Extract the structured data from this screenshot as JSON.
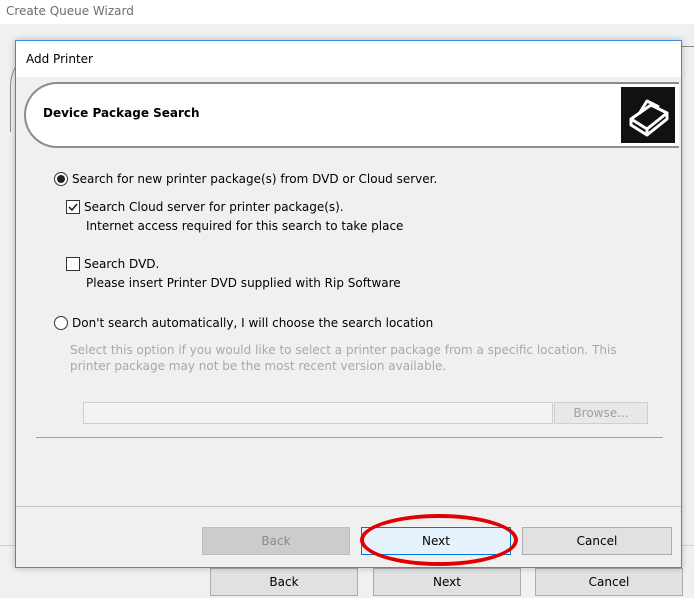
{
  "outer": {
    "title": "Create Queue Wizard",
    "back_label": "Back",
    "next_label": "Next",
    "cancel_label": "Cancel"
  },
  "dialog": {
    "title": "Add Printer",
    "section_title": "Device Package Search",
    "option_search": {
      "label": "Search for new printer package(s) from DVD or Cloud server.",
      "selected": true
    },
    "cloud": {
      "label": "Search Cloud server for printer package(s).",
      "note": "Internet access required for this search to take place",
      "checked": true
    },
    "dvd": {
      "label": "Search DVD.",
      "note": "Please insert Printer DVD supplied with Rip Software",
      "checked": false
    },
    "option_manual": {
      "label": "Don't search automatically, I will choose the search location",
      "selected": false,
      "description_line1": "Select this option if you would like to select a printer package from a specific location. This",
      "description_line2": "printer package may not be the most recent version available."
    },
    "path_value": "",
    "browse_label": "Browse...",
    "back_label": "Back",
    "next_label": "Next",
    "cancel_label": "Cancel"
  },
  "icons": {
    "printer": "printer-icon",
    "radio_selected": "radio-selected-icon",
    "checkbox_checked": "checkmark-icon"
  },
  "colors": {
    "accent_border": "#0078d7",
    "annotation": "#e00000"
  }
}
